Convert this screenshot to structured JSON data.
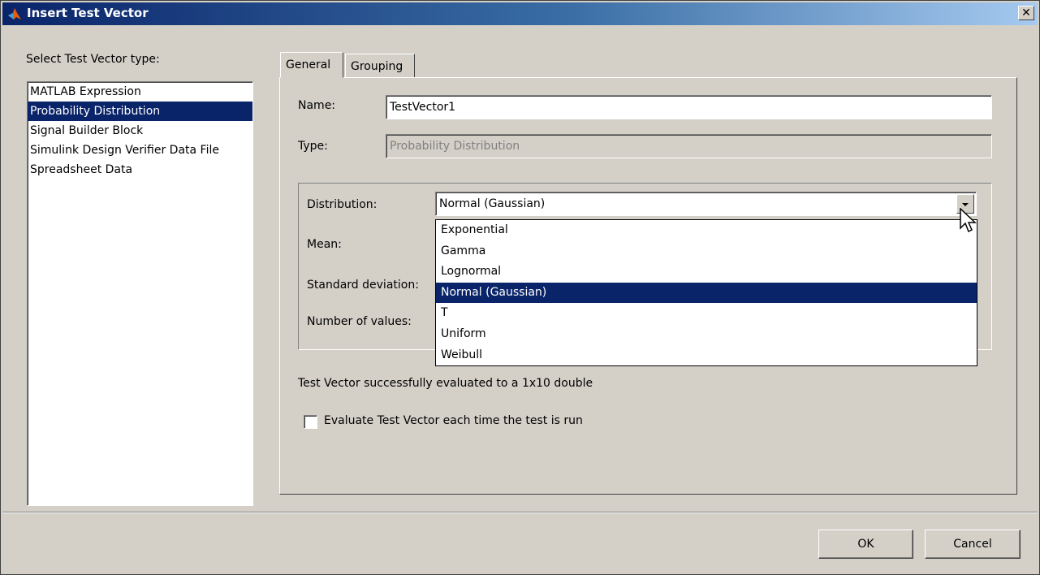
{
  "window": {
    "title": "Insert Test Vector",
    "close_glyph": "✕"
  },
  "left_panel": {
    "label": "Select Test Vector type:",
    "items": [
      "MATLAB Expression",
      "Probability Distribution",
      "Signal Builder Block",
      "Simulink Design Verifier Data File",
      "Spreadsheet Data"
    ],
    "selected_index": 1
  },
  "tabs": [
    {
      "label": "General",
      "active": true
    },
    {
      "label": "Grouping",
      "active": false
    }
  ],
  "general": {
    "name_label": "Name:",
    "name_value": "TestVector1",
    "type_label": "Type:",
    "type_value": "Probability Distribution",
    "distribution_label": "Distribution:",
    "distribution_value": "Normal (Gaussian)",
    "mean_label": "Mean:",
    "std_label": "Standard deviation:",
    "num_values_label": "Number of values:",
    "distribution_options": [
      "Exponential",
      "Gamma",
      "Lognormal",
      "Normal (Gaussian)",
      "T",
      "Uniform",
      "Weibull"
    ],
    "selected_option_index": 3,
    "status_text": "Test Vector successfully evaluated to a 1x10 double",
    "checkbox_label": "Evaluate Test Vector each time the test is run",
    "checkbox_checked": false
  },
  "buttons": {
    "ok": "OK",
    "cancel": "Cancel"
  },
  "colors": {
    "selection": "#0a246a",
    "face": "#d4d0c8",
    "title_start": "#0a246a"
  }
}
